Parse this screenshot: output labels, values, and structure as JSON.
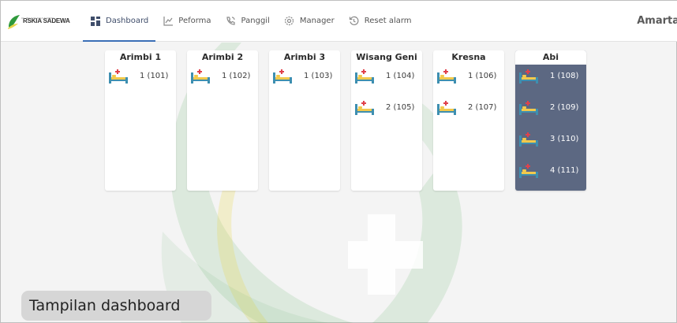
{
  "brand": {
    "logo_text": "RSKIA SADEWA",
    "logo_subtext": "RS. IBU DAN ANAK SADEWA"
  },
  "nav": [
    {
      "label": "Dashboard",
      "icon": "dashboard-icon",
      "active": true
    },
    {
      "label": "Peforma",
      "icon": "chart-icon",
      "active": false
    },
    {
      "label": "Panggil",
      "icon": "phone-icon",
      "active": false
    },
    {
      "label": "Manager",
      "icon": "settings-icon",
      "active": false
    },
    {
      "label": "Reset alarm",
      "icon": "reset-icon",
      "active": false
    }
  ],
  "user": {
    "name": "Amarta"
  },
  "wards": [
    {
      "name": "Arimbi 1",
      "beds": [
        "1 (101)"
      ]
    },
    {
      "name": "Arimbi 2",
      "beds": [
        "1 (102)"
      ]
    },
    {
      "name": "Arimbi 3",
      "beds": [
        "1 (103)"
      ]
    },
    {
      "name": "Wisang Geni",
      "beds": [
        "1 (104)",
        "2 (105)"
      ]
    },
    {
      "name": "Kresna",
      "beds": [
        "1 (106)",
        "2 (107)"
      ]
    },
    {
      "name": "Abi",
      "beds": [
        "1 (108)",
        "2 (109)",
        "3 (110)",
        "4 (111)"
      ],
      "highlighted": true
    }
  ],
  "caption": "Tampilan dashboard",
  "colors": {
    "accent": "#3b6fb6",
    "highlighted_ward": "#5c6882",
    "watermark_green": "#2f9a3c",
    "watermark_yellow": "#e8d64a",
    "bed_frame": "#3e8fb0",
    "bed_cross": "#e0414b",
    "bed_mattress": "#f2c94c"
  }
}
